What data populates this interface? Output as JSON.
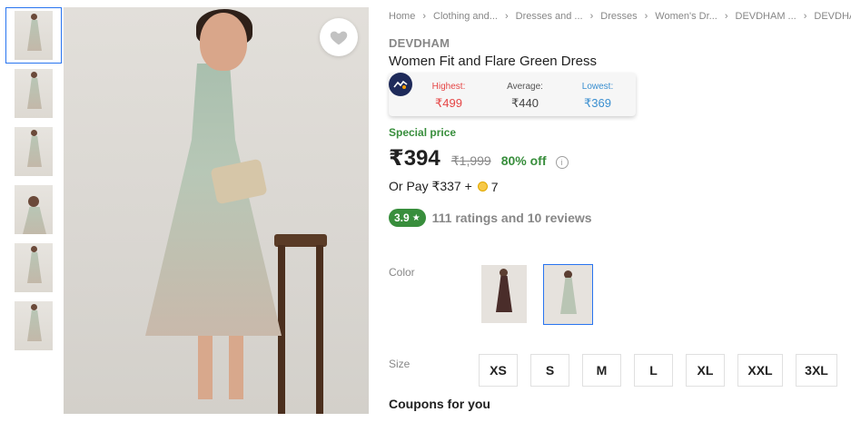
{
  "breadcrumbs": [
    "Home",
    "Clothing and...",
    "Dresses and ...",
    "Dresses",
    "Women's Dr...",
    "DEVDHAM ...",
    "DEVDHAM ..."
  ],
  "product": {
    "brand": "DEVDHAM",
    "title": "Women Fit and Flare Green Dress"
  },
  "price_tracker": {
    "highest_label": "Highest:",
    "highest_value": "₹499",
    "average_label": "Average:",
    "average_value": "₹440",
    "lowest_label": "Lowest:",
    "lowest_value": "₹369"
  },
  "pricing": {
    "special_label": "Special price",
    "price": "₹394",
    "mrp": "₹1,999",
    "discount": "80% off",
    "or_pay_text": "Or Pay ₹337 +",
    "coins": "7"
  },
  "rating": {
    "score": "3.9",
    "summary": "111 ratings and 10 reviews"
  },
  "color": {
    "label": "Color",
    "options": [
      "dark-brown",
      "green-print"
    ],
    "selected": "green-print"
  },
  "size": {
    "label": "Size",
    "options": [
      "XS",
      "S",
      "M",
      "L",
      "XL",
      "XXL",
      "3XL"
    ]
  },
  "coupons_heading": "Coupons for you",
  "colors": {
    "accent": "#2874f0",
    "green": "#388e3c",
    "high": "#e54545",
    "low": "#3a8fd0"
  },
  "icons": {
    "wishlist": "heart-icon",
    "tracker": "price-trend-icon",
    "info": "info-icon",
    "coin": "supercoin-icon",
    "star": "star-icon"
  }
}
